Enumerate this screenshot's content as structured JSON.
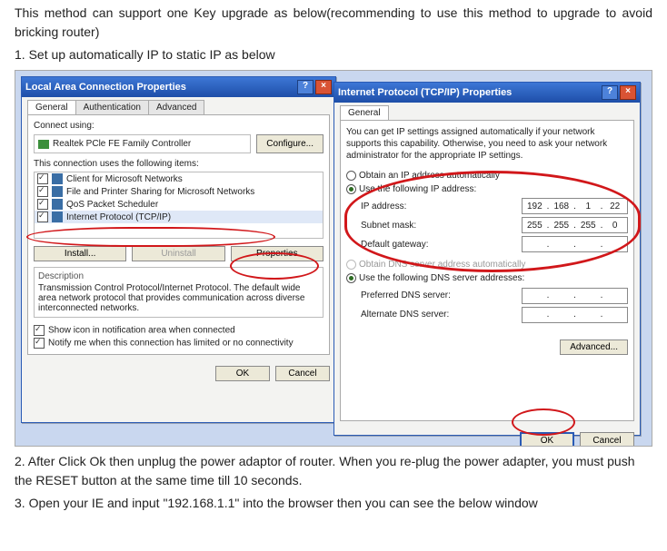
{
  "intro": "This method can support one Key upgrade as below(recommending to use this method to upgrade to avoid bricking router)",
  "step1": "1.  Set up automatically IP to static IP as below",
  "step2": "2. After Click Ok    then unplug the power adaptor of router. When you re-plug the power adapter, you must push the RESET button at the same time till 10 seconds.",
  "step3": "3. Open your IE and input \"192.168.1.1\" into the browser    then you can see the below window",
  "lac": {
    "title": "Local Area Connection Properties",
    "tabs": [
      "General",
      "Authentication",
      "Advanced"
    ],
    "connect_using_label": "Connect using:",
    "nic": "Realtek PCle FE Family Controller",
    "configure": "Configure...",
    "items_label": "This connection uses the following items:",
    "items": [
      "Client for Microsoft Networks",
      "File and Printer Sharing for Microsoft Networks",
      "QoS Packet Scheduler",
      "Internet Protocol (TCP/IP)"
    ],
    "install": "Install...",
    "uninstall": "Uninstall",
    "properties": "Properties",
    "desc_title": "Description",
    "desc_text": "Transmission Control Protocol/Internet Protocol. The default wide area network protocol that provides communication across diverse interconnected networks.",
    "show_icon": "Show icon in notification area when connected",
    "notify": "Notify me when this connection has limited or no connectivity",
    "ok": "OK",
    "cancel": "Cancel"
  },
  "tcpip": {
    "title": "Internet Protocol (TCP/IP) Properties",
    "tab": "General",
    "blurb": "You can get IP settings assigned automatically if your network supports this capability. Otherwise, you need to ask your network administrator for the appropriate IP settings.",
    "obtain_ip": "Obtain an IP address automatically",
    "use_ip": "Use the following IP address:",
    "ip_label": "IP address:",
    "ip_value": [
      "192",
      "168",
      "1",
      "22"
    ],
    "subnet_label": "Subnet mask:",
    "subnet_value": [
      "255",
      "255",
      "255",
      "0"
    ],
    "gateway_label": "Default gateway:",
    "obtain_dns": "Obtain DNS server address automatically",
    "use_dns": "Use the following DNS server addresses:",
    "pref_dns": "Preferred DNS server:",
    "alt_dns": "Alternate DNS server:",
    "advanced": "Advanced...",
    "ok": "OK",
    "cancel": "Cancel"
  }
}
